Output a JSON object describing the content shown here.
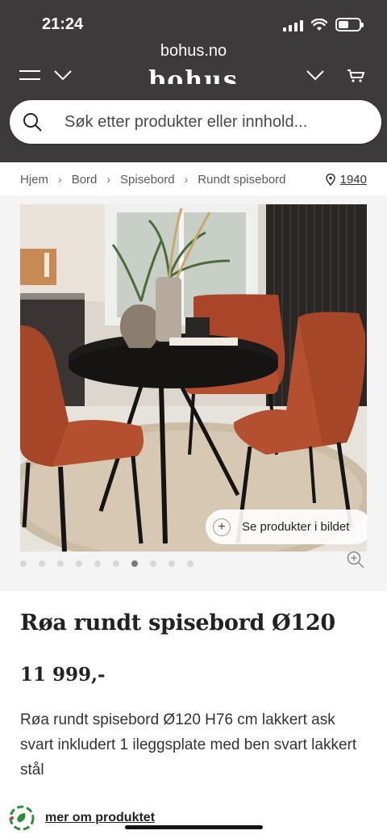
{
  "status_bar": {
    "time": "21:24"
  },
  "browser": {
    "url": "bohus.no"
  },
  "header": {
    "brand": "bohus"
  },
  "search": {
    "placeholder": "Søk etter produkter eller innhold..."
  },
  "breadcrumb": {
    "items": [
      "Hjem",
      "Bord",
      "Spisebord",
      "Rundt spisebord"
    ],
    "location": "1940"
  },
  "gallery": {
    "cta_label": "Se produkter i bildet",
    "dot_count": 10,
    "active_dot": 6
  },
  "product": {
    "title": "Røa rundt spisebord Ø120",
    "price": "11 999,-",
    "description": "Røa rundt spisebord Ø120 H76 cm lakkert ask svart inkludert 1 ileggsplate med ben svart lakkert stål",
    "more_link": "mer om produktet"
  },
  "colors": {
    "header_bg": "#3c3a3b",
    "gallery_bg": "#f4f4f4",
    "chair": "#b4502f",
    "eco_green": "#2e8b3a"
  }
}
